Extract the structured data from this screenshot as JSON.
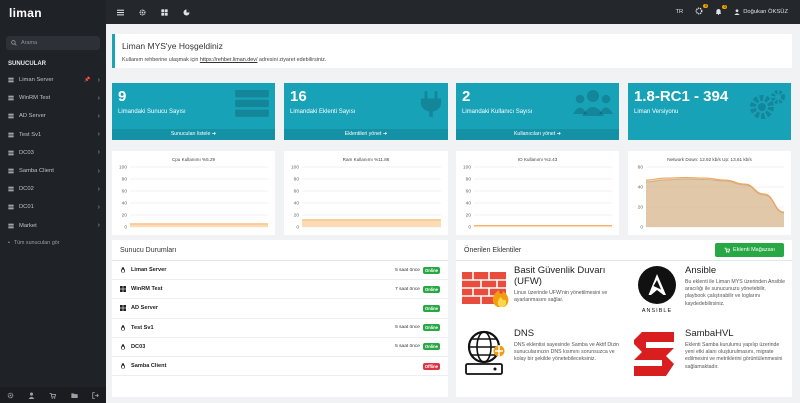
{
  "app": {
    "logo": "liman"
  },
  "sidebar": {
    "search_placeholder": "Arama",
    "section_title": "SUNUCULAR",
    "servers": [
      {
        "label": "Liman Server",
        "pinned": true
      },
      {
        "label": "WinRM Test",
        "pinned": false
      },
      {
        "label": "AD Server",
        "pinned": false
      },
      {
        "label": "Test Sv1",
        "pinned": false
      },
      {
        "label": "DC03",
        "pinned": false
      },
      {
        "label": "Samba Client",
        "pinned": false
      },
      {
        "label": "DC02",
        "pinned": false
      },
      {
        "label": "DC01",
        "pinned": false
      },
      {
        "label": "Market",
        "pinned": false
      }
    ],
    "all_servers_link": "Tüm sunucuları gör"
  },
  "topbar": {
    "language": "TR",
    "task_badge": "0",
    "notification_badge": "0",
    "user_name": "Doğukan ÖKSÜZ"
  },
  "welcome": {
    "title": "Liman MYS'ye Hoşgeldiniz",
    "text_before": "Kullanım rehberine ulaşmak için ",
    "link": "https://rehber.liman.dev/",
    "text_after": " adresini ziyaret edebilirsiniz."
  },
  "stats": [
    {
      "value": "9",
      "label": "Limandaki Sunucu Sayısı",
      "footer": "Sunucuları listele",
      "icon": "server-icon"
    },
    {
      "value": "16",
      "label": "Limandaki Eklenti Sayısı",
      "footer": "Eklentileri yönet",
      "icon": "plug-icon"
    },
    {
      "value": "2",
      "label": "Limandaki Kullanıcı Sayısı",
      "footer": "Kullanıcıları yönet",
      "icon": "users-icon"
    },
    {
      "value": "1.8-RC1 - 394",
      "label": "Liman Versiyonu",
      "footer": "",
      "icon": "gears-icon"
    }
  ],
  "colors": {
    "accent": "#17a2b8",
    "online": "#28a745",
    "offline": "#dc3545",
    "chart_line": "#f7b267",
    "chart_fill": "#fcdcb5",
    "net_fill": "#d9b991",
    "net_line": "#f0a45c"
  },
  "chart_data": [
    {
      "type": "area",
      "title": "Cpu Kullanımı %5.29",
      "ylim": [
        0,
        100
      ],
      "yticks": [
        0,
        20,
        40,
        60,
        80,
        100
      ],
      "values": [
        5.3,
        5.3,
        5.3,
        5.3,
        5.3,
        5.3,
        5.3,
        5.3
      ]
    },
    {
      "type": "area",
      "title": "Ram Kullanımı %11.86",
      "ylim": [
        0,
        100
      ],
      "yticks": [
        0,
        20,
        40,
        60,
        80,
        100
      ],
      "values": [
        11.9,
        11.9,
        11.9,
        11.9,
        11.9,
        11.9,
        11.9,
        11.9
      ]
    },
    {
      "type": "area",
      "title": "IO Kullanımı %2.43",
      "ylim": [
        0,
        100
      ],
      "yticks": [
        0,
        20,
        40,
        60,
        80,
        100
      ],
      "values": [
        2.4,
        2.4,
        2.4,
        2.4,
        2.4,
        2.4,
        2.4,
        2.4
      ]
    },
    {
      "type": "area",
      "title": "Network Down: 12.92 kb/s Up: 13.61 kb/s",
      "ylim": [
        0,
        60
      ],
      "yticks": [
        0,
        20,
        40,
        60
      ],
      "series": [
        {
          "name": "Down",
          "values": [
            45,
            47,
            48,
            47.5,
            46,
            42,
            32,
            14
          ]
        },
        {
          "name": "Up",
          "values": [
            47,
            49,
            49.5,
            49,
            47,
            43,
            33,
            15
          ]
        }
      ]
    }
  ],
  "server_status": {
    "title": "Sunucu Durumları",
    "rows": [
      {
        "name": "Liman Server",
        "time": "5 saat önce",
        "status": "Online",
        "icon": "linux-icon"
      },
      {
        "name": "WinRM Test",
        "time": "7 saat önce",
        "status": "Online",
        "icon": "windows-icon"
      },
      {
        "name": "AD Server",
        "time": "",
        "status": "Online",
        "icon": "windows-icon"
      },
      {
        "name": "Test Sv1",
        "time": "5 saat önce",
        "status": "Online",
        "icon": "linux-icon"
      },
      {
        "name": "DC03",
        "time": "5 saat önce",
        "status": "Online",
        "icon": "linux-icon"
      },
      {
        "name": "Samba Client",
        "time": "",
        "status": "Offline",
        "icon": "linux-icon"
      }
    ]
  },
  "extensions": {
    "title": "Önerilen Eklentiler",
    "store_button": "Eklenti Mağazası",
    "items": [
      {
        "name": "Basit Güvenlik Duvarı (UFW)",
        "desc": "Linux üzerinde UFW'nin yönetilmesini ve ayarlanmasını sağlar.",
        "icon": "firewall-icon"
      },
      {
        "name": "Ansible",
        "desc": "Bu eklenti ile Liman MYS üzerinden Ansible aracılığı ile sunucunuzu yönetebilir, playbook çalıştırabilir ve loglarını kaydedebilirsiniz.",
        "icon": "ansible-logo",
        "logo_text": "ANSIBLE"
      },
      {
        "name": "DNS",
        "desc": "DNS eklentisi sayesinde Samba ve Aktif Dizin sunucularınızın DNS kısmını sorunsuzca ve kolay bir şekilde yönetebileceksiniz.",
        "icon": "dns-icon"
      },
      {
        "name": "SambaHVL",
        "desc": "Eklenti Samba kurulumu yapılıp üzerinde yeni etki alanı oluşturulmasını, migrate edilmesini ve metriklerini görüntülenmesini sağlamaktadır.",
        "icon": "samba-icon"
      }
    ]
  }
}
